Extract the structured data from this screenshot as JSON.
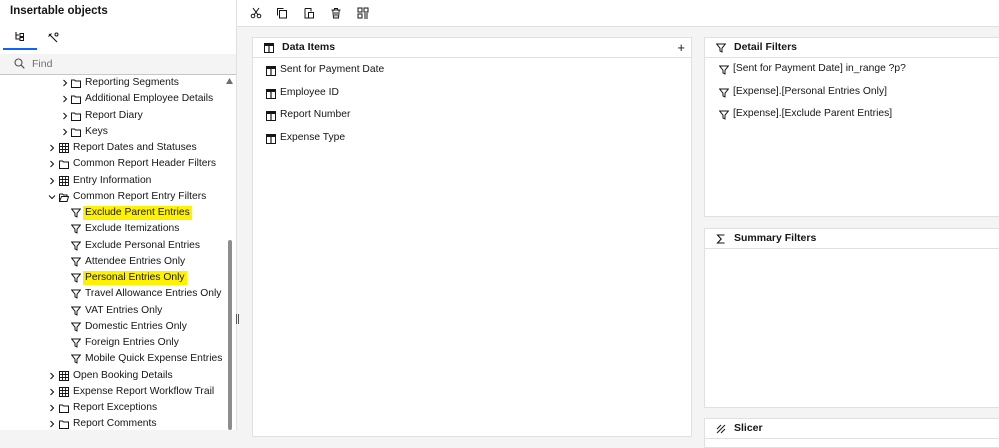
{
  "left_panel": {
    "title": "Insertable objects",
    "tabs": [
      {
        "icon": "source-tree-icon",
        "selected": true
      },
      {
        "icon": "toolbox-icon",
        "selected": false
      }
    ],
    "search": {
      "placeholder": "Find",
      "value": ""
    },
    "tree": [
      {
        "label": "Reporting Segments",
        "icon": "folder-icon",
        "expand": "collapsed",
        "highlighted": false
      },
      {
        "label": "Additional Employee Details",
        "icon": "folder-icon",
        "expand": "collapsed",
        "highlighted": false
      },
      {
        "label": "Report Diary",
        "icon": "folder-icon",
        "expand": "collapsed",
        "highlighted": false
      },
      {
        "label": "Keys",
        "icon": "folder-icon",
        "expand": "collapsed",
        "highlighted": false
      },
      {
        "label": "Report Dates and Statuses",
        "icon": "table-icon",
        "expand": "collapsed",
        "highlighted": false
      },
      {
        "label": "Common Report Header Filters",
        "icon": "folder-icon",
        "expand": "collapsed",
        "highlighted": false
      },
      {
        "label": "Entry Information",
        "icon": "table-icon",
        "expand": "collapsed",
        "highlighted": false
      },
      {
        "label": "Common Report Entry Filters",
        "icon": "folder-open-icon",
        "expand": "expanded",
        "highlighted": false
      },
      {
        "label": "Exclude Parent Entries",
        "icon": "filter-icon",
        "expand": "none",
        "highlighted": true
      },
      {
        "label": "Exclude Itemizations",
        "icon": "filter-icon",
        "expand": "none",
        "highlighted": false
      },
      {
        "label": "Exclude Personal Entries",
        "icon": "filter-icon",
        "expand": "none",
        "highlighted": false
      },
      {
        "label": "Attendee Entries Only",
        "icon": "filter-icon",
        "expand": "none",
        "highlighted": false
      },
      {
        "label": "Personal Entries Only",
        "icon": "filter-icon",
        "expand": "none",
        "highlighted": true
      },
      {
        "label": "Travel Allowance Entries Only",
        "icon": "filter-icon",
        "expand": "none",
        "highlighted": false
      },
      {
        "label": "VAT Entries Only",
        "icon": "filter-icon",
        "expand": "none",
        "highlighted": false
      },
      {
        "label": "Domestic Entries Only",
        "icon": "filter-icon",
        "expand": "none",
        "highlighted": false
      },
      {
        "label": "Foreign Entries Only",
        "icon": "filter-icon",
        "expand": "none",
        "highlighted": false
      },
      {
        "label": "Mobile Quick Expense Entries on",
        "icon": "filter-icon",
        "expand": "none",
        "highlighted": false
      },
      {
        "label": "Open Booking Details",
        "icon": "table-icon",
        "expand": "collapsed",
        "highlighted": false
      },
      {
        "label": "Expense Report Workflow Trail",
        "icon": "table-icon",
        "expand": "collapsed",
        "highlighted": false
      },
      {
        "label": "Report Exceptions",
        "icon": "folder-icon",
        "expand": "collapsed",
        "highlighted": false
      },
      {
        "label": "Report Comments",
        "icon": "folder-icon",
        "expand": "collapsed",
        "highlighted": false
      }
    ]
  },
  "toolbar": {
    "buttons": [
      "cut-icon",
      "copy-icon",
      "paste-icon",
      "delete-icon",
      "grid-icon"
    ]
  },
  "data_items": {
    "title": "Data Items",
    "add_label": "+",
    "items": [
      "Sent for Payment Date",
      "Employee ID",
      "Report Number",
      "Expense Type"
    ]
  },
  "detail_filters": {
    "title": "Detail Filters",
    "items": [
      "[Sent for Payment Date] in_range ?p?",
      "[Expense].[Personal Entries Only]",
      "[Expense].[Exclude Parent Entries]"
    ]
  },
  "summary_filters": {
    "title": "Summary Filters",
    "items": []
  },
  "slicer": {
    "title": "Slicer"
  },
  "colors": {
    "highlight": "#fff200",
    "accent": "#0f62fe",
    "panel_background": "#f4f4f4"
  }
}
